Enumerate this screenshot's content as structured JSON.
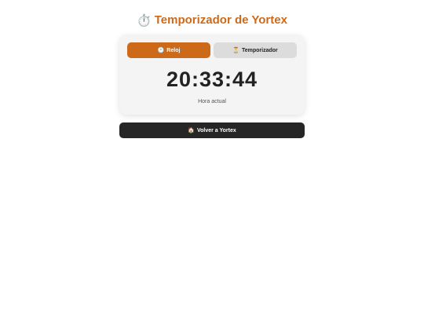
{
  "header": {
    "icon": "stopwatch-icon",
    "icon_glyph": "⏱️",
    "title": "Temporizador de Yortex"
  },
  "tabs": [
    {
      "label": "Reloj",
      "icon": "clock-icon",
      "icon_glyph": "🕐",
      "active": true
    },
    {
      "label": "Temporizador",
      "icon": "hourglass-icon",
      "icon_glyph": "⏳",
      "active": false
    }
  ],
  "clock": {
    "time": "20:33:44",
    "caption": "Hora actual"
  },
  "back_button": {
    "icon": "house-icon",
    "icon_glyph": "🏠",
    "label": "Volver a Yortex"
  },
  "colors": {
    "accent": "#cd6a1a",
    "dark": "#262626",
    "card": "#f4f4f4",
    "inactive_tab": "#dcdcdc"
  }
}
